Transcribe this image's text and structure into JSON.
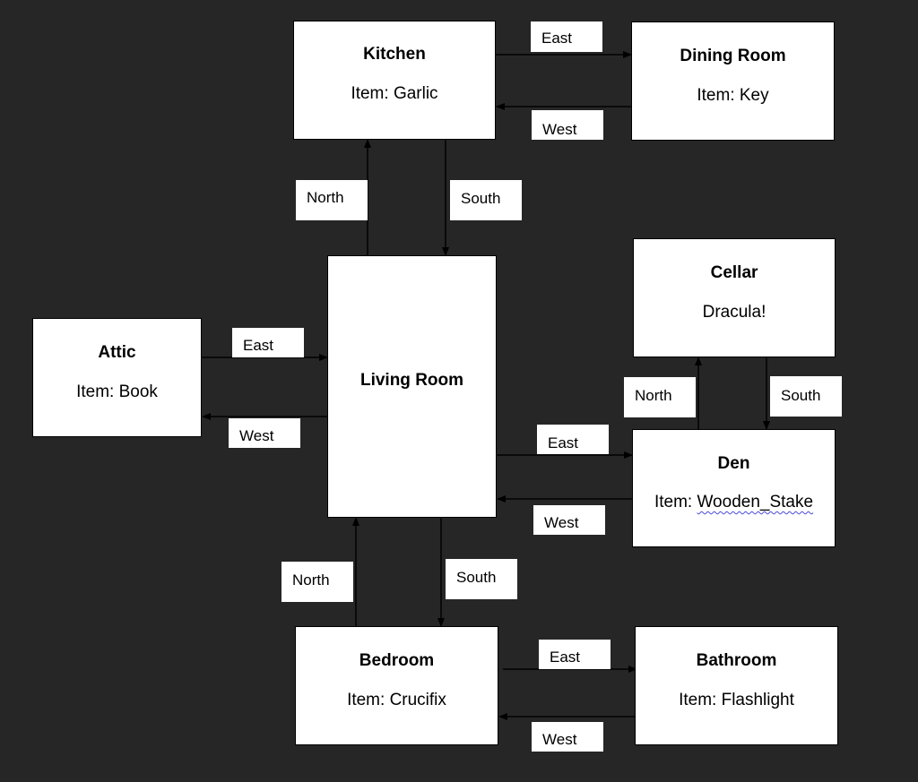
{
  "background_color": "#262626",
  "rooms": {
    "kitchen": {
      "name": "Kitchen",
      "item": "Item: Garlic"
    },
    "dining_room": {
      "name": "Dining Room",
      "item": "Item: Key"
    },
    "cellar": {
      "name": "Cellar",
      "item": "Dracula!"
    },
    "attic": {
      "name": "Attic",
      "item": "Item: Book"
    },
    "living_room": {
      "name": "Living Room",
      "item": ""
    },
    "den": {
      "name": "Den",
      "item_prefix": "Item: ",
      "item_value": "Wooden_Stake"
    },
    "bedroom": {
      "name": "Bedroom",
      "item": "Item: Crucifix"
    },
    "bathroom": {
      "name": "Bathroom",
      "item": "Item: Flashlight"
    }
  },
  "connections": [
    {
      "from": "Kitchen",
      "to": "Dining Room",
      "label": "East"
    },
    {
      "from": "Dining Room",
      "to": "Kitchen",
      "label": "West"
    },
    {
      "from": "Living Room",
      "to": "Kitchen",
      "label": "North"
    },
    {
      "from": "Kitchen",
      "to": "Living Room",
      "label": "South"
    },
    {
      "from": "Attic",
      "to": "Living Room",
      "label": "East"
    },
    {
      "from": "Living Room",
      "to": "Attic",
      "label": "West"
    },
    {
      "from": "Den",
      "to": "Cellar",
      "label": "North"
    },
    {
      "from": "Cellar",
      "to": "Den",
      "label": "South"
    },
    {
      "from": "Living Room",
      "to": "Den",
      "label": "East"
    },
    {
      "from": "Den",
      "to": "Living Room",
      "label": "West"
    },
    {
      "from": "Bedroom",
      "to": "Living Room",
      "label": "North"
    },
    {
      "from": "Living Room",
      "to": "Bedroom",
      "label": "South"
    },
    {
      "from": "Bedroom",
      "to": "Bathroom",
      "label": "East"
    },
    {
      "from": "Bathroom",
      "to": "Bedroom",
      "label": "West"
    }
  ]
}
